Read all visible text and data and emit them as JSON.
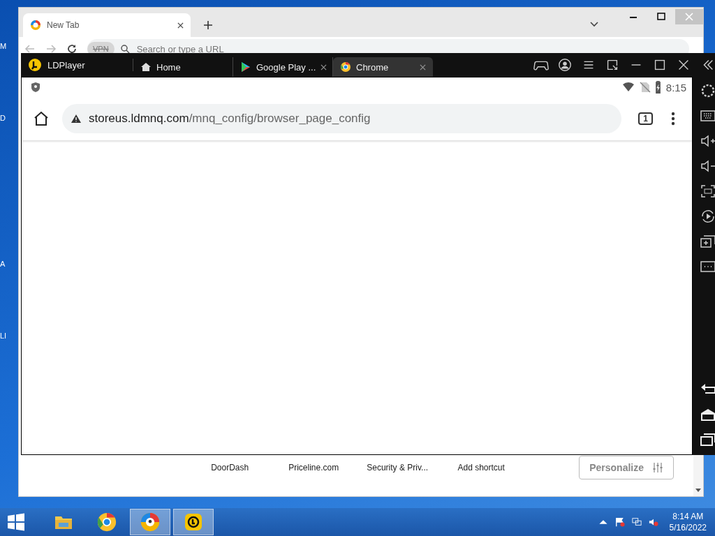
{
  "desktop": {
    "edge_labels": [
      "M",
      "D",
      "A",
      "LI"
    ]
  },
  "browser": {
    "tabs": [
      {
        "label": "New Tab",
        "selected": true
      }
    ],
    "omnibox": {
      "vpn_label": "VPN",
      "placeholder": "Search or type a URL"
    },
    "shortcuts": [
      "DoorDash",
      "Priceline.com",
      "Security & Priv...",
      "Add shortcut"
    ],
    "personalize_button": "Personalize"
  },
  "ldplayer": {
    "title": "LDPlayer",
    "tabs": [
      {
        "kind": "home",
        "label": "Home",
        "selected": false,
        "closable": false
      },
      {
        "kind": "play",
        "label": "Google Play ...",
        "selected": false,
        "closable": true
      },
      {
        "kind": "chrome",
        "label": "Chrome",
        "selected": true,
        "closable": true
      }
    ],
    "status_bar": {
      "time": "8:15"
    },
    "address_bar": {
      "domain": "storeus.ldmnq.com",
      "path": "/mnq_config/browser_page_config"
    },
    "tab_count": "1"
  },
  "taskbar": {
    "apps": [
      {
        "kind": "explorer",
        "open": false
      },
      {
        "kind": "chrome",
        "open": false
      },
      {
        "kind": "browser",
        "open": true
      },
      {
        "kind": "ldplayer",
        "open": true
      }
    ],
    "clock": {
      "time": "8:14 AM",
      "date": "5/16/2022"
    }
  }
}
